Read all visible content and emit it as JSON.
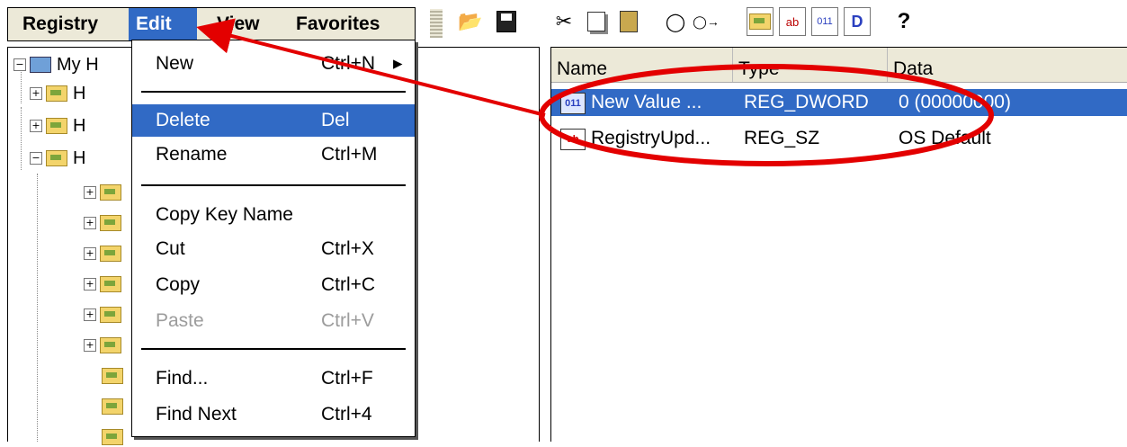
{
  "menubar": {
    "items": [
      {
        "label": "Registry"
      },
      {
        "label": "Edit"
      },
      {
        "label": "View"
      },
      {
        "label": "Favorites"
      }
    ]
  },
  "toolbar": {
    "icons": [
      "open-icon",
      "save-icon",
      "cut-icon",
      "copy-icon",
      "paste-icon",
      "find-icon",
      "find-next-icon",
      "new-key-icon",
      "new-string-icon",
      "new-binary-icon",
      "new-dword-icon",
      "help-icon"
    ]
  },
  "tree": {
    "root_label": "My H",
    "child_labels": [
      "H",
      "H",
      "H"
    ]
  },
  "edit_menu": {
    "items": [
      {
        "label": "New",
        "accel": "Ctrl+N"
      },
      {
        "label": "Delete",
        "accel": "Del"
      },
      {
        "label": "Rename",
        "accel": "Ctrl+M"
      },
      {
        "label": "Copy Key Name",
        "accel": ""
      },
      {
        "label": "Cut",
        "accel": "Ctrl+X"
      },
      {
        "label": "Copy",
        "accel": "Ctrl+C"
      },
      {
        "label": "Paste",
        "accel": "Ctrl+V"
      },
      {
        "label": "Find...",
        "accel": "Ctrl+F"
      },
      {
        "label": "Find Next",
        "accel": "Ctrl+4"
      }
    ],
    "submenu_arrow": "▸"
  },
  "list": {
    "columns": [
      "Name",
      "Type",
      "Data"
    ],
    "rows": [
      {
        "icon": "dword-value-icon",
        "name": "New Value ...",
        "type": "REG_DWORD",
        "data": "0 (00000000)"
      },
      {
        "icon": "string-value-icon",
        "name": "RegistryUpd...",
        "type": "REG_SZ",
        "data": "OS Default"
      }
    ]
  },
  "colors": {
    "selection": "#316ac5",
    "chrome": "#ece9d8",
    "annotation": "#e30000"
  }
}
